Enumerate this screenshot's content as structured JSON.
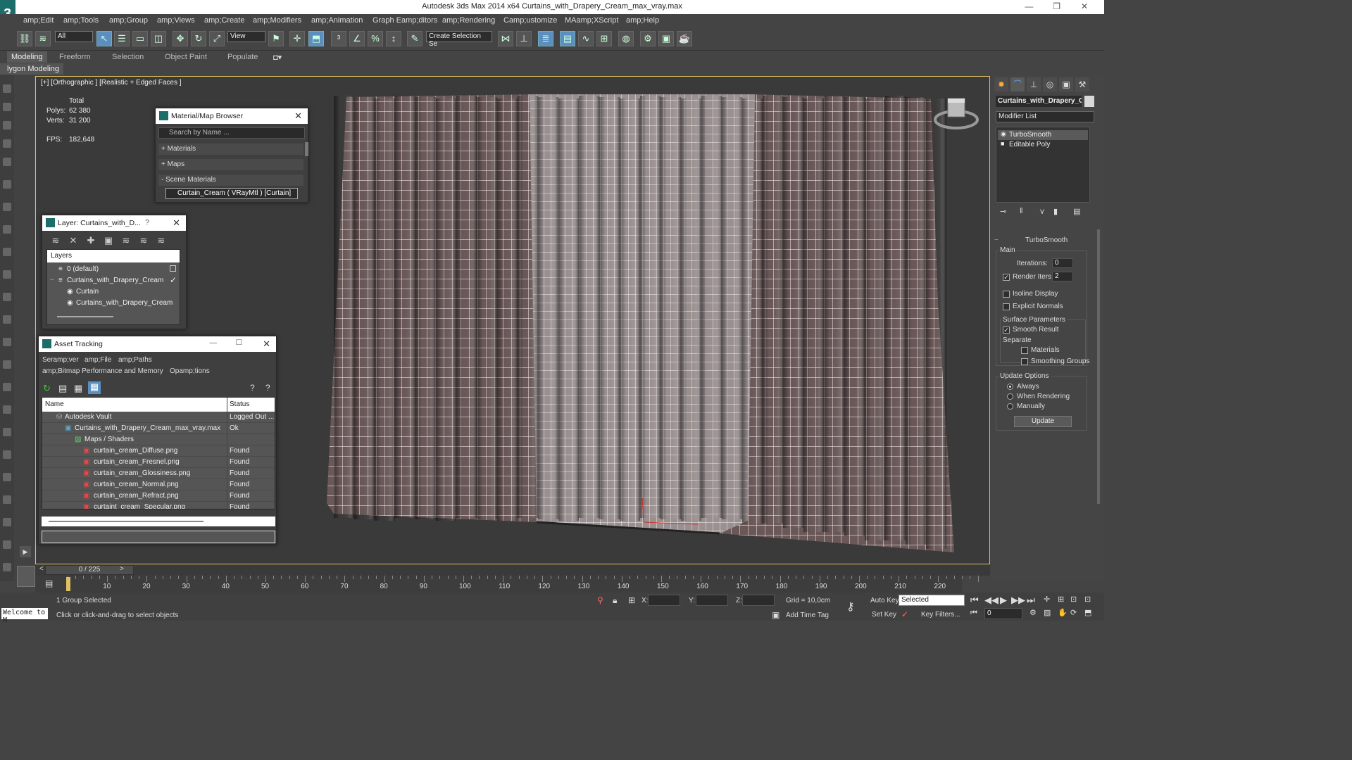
{
  "window": {
    "title": "Autodesk 3ds Max  2014 x64      Curtains_with_Drapery_Cream_max_vray.max",
    "controls": [
      "—",
      "❐",
      "✕"
    ]
  },
  "menu": [
    "amp;Edit",
    "amp;Tools",
    "amp;Group",
    "amp;Views",
    "amp;Create",
    "amp;Modifiers",
    "amp;Animation",
    "Graph Eamp;ditors",
    "amp;Rendering",
    "Camp;ustomize",
    "MAamp;XScript",
    "amp;Help"
  ],
  "toolbar": {
    "filter": "All",
    "refcoord": "View",
    "selset": "Create Selection Se"
  },
  "ribbon": {
    "tabs": [
      "Modeling",
      "Freeform",
      "Selection",
      "Object Paint",
      "Populate"
    ],
    "sub": "lygon Modeling"
  },
  "viewport": {
    "label": "[+] [Orthographic ] [Realistic + Edged Faces ]",
    "stats": {
      "total": "Total",
      "polys_label": "Polys:",
      "polys": "62 380",
      "verts_label": "Verts:",
      "verts": "31 200",
      "fps_label": "FPS:",
      "fps": "182,648"
    }
  },
  "material_browser": {
    "title": "Material/Map Browser",
    "search": "Search by Name ...",
    "sections": [
      "+ Materials",
      "+ Maps",
      "- Scene Materials"
    ],
    "item": "Curtain_Cream  ( VRayMtl )  [Curtain]"
  },
  "layer_dialog": {
    "title": "Layer: Curtains_with_D...",
    "help": "?",
    "header": "Layers",
    "items": [
      "0 (default)",
      "Curtains_with_Drapery_Cream",
      "Curtain",
      "Curtains_with_Drapery_Cream"
    ]
  },
  "asset_tracking": {
    "title": "Asset Tracking",
    "menu": [
      "Seramp;ver",
      "amp;File",
      "amp;Paths",
      "amp;Bitmap Performance and Memory",
      "Opamp;tions"
    ],
    "columns": [
      "Name",
      "Status"
    ],
    "rows": [
      {
        "name": "Autodesk Vault",
        "status": "Logged Out ..."
      },
      {
        "name": "Curtains_with_Drapery_Cream_max_vray.max",
        "status": "Ok"
      },
      {
        "name": "Maps / Shaders",
        "status": ""
      },
      {
        "name": "curtain_cream_Diffuse.png",
        "status": "Found"
      },
      {
        "name": "curtain_cream_Fresnel.png",
        "status": "Found"
      },
      {
        "name": "curtain_cream_Glossiness.png",
        "status": "Found"
      },
      {
        "name": "curtain_cream_Normal.png",
        "status": "Found"
      },
      {
        "name": "curtain_cream_Refract.png",
        "status": "Found"
      },
      {
        "name": "curtaint_cream_Specular.png",
        "status": "Found"
      }
    ]
  },
  "command_panel": {
    "object_name": "Curtains_with_Drapery_C",
    "modifier_list": "Modifier List",
    "stack": [
      "TurboSmooth",
      "Editable Poly"
    ],
    "rollout": {
      "title": "TurboSmooth",
      "main": "Main",
      "iterations_label": "Iterations:",
      "iterations": "0",
      "render_iters_label": "Render Iters:",
      "render_iters": "2",
      "isoline": "Isoline Display",
      "explicit": "Explicit Normals",
      "surface": "Surface Parameters",
      "smooth_result": "Smooth Result",
      "separate": "Separate",
      "materials": "Materials",
      "smoothing_groups": "Smoothing Groups",
      "update_options": "Update Options",
      "always": "Always",
      "when_rendering": "When Rendering",
      "manually": "Manually",
      "update": "Update"
    }
  },
  "timeline": {
    "slider": "0 / 225",
    "ticks": [
      "10",
      "20",
      "30",
      "40",
      "50",
      "60",
      "70",
      "80",
      "90",
      "100",
      "110",
      "120",
      "130",
      "140",
      "150",
      "160",
      "170",
      "180",
      "190",
      "200",
      "210",
      "220"
    ]
  },
  "status": {
    "selected": "1 Group Selected",
    "prompt": "Click or click-and-drag to select objects",
    "welcome": "Welcome to M",
    "x_label": "X:",
    "y_label": "Y:",
    "z_label": "Z:",
    "grid": "Grid = 10,0cm",
    "add_time_tag": "Add Time Tag",
    "auto_key": "Auto Key",
    "set_key": "Set Key",
    "selected_set": "Selected",
    "key_filters": "Key Filters...",
    "frame": "0"
  },
  "colors": {
    "accent": "#5a8fc0",
    "viewport_border": "#e0c060",
    "curtain_mesh": "#d8c8c8",
    "logo": "#1c6d6a"
  }
}
